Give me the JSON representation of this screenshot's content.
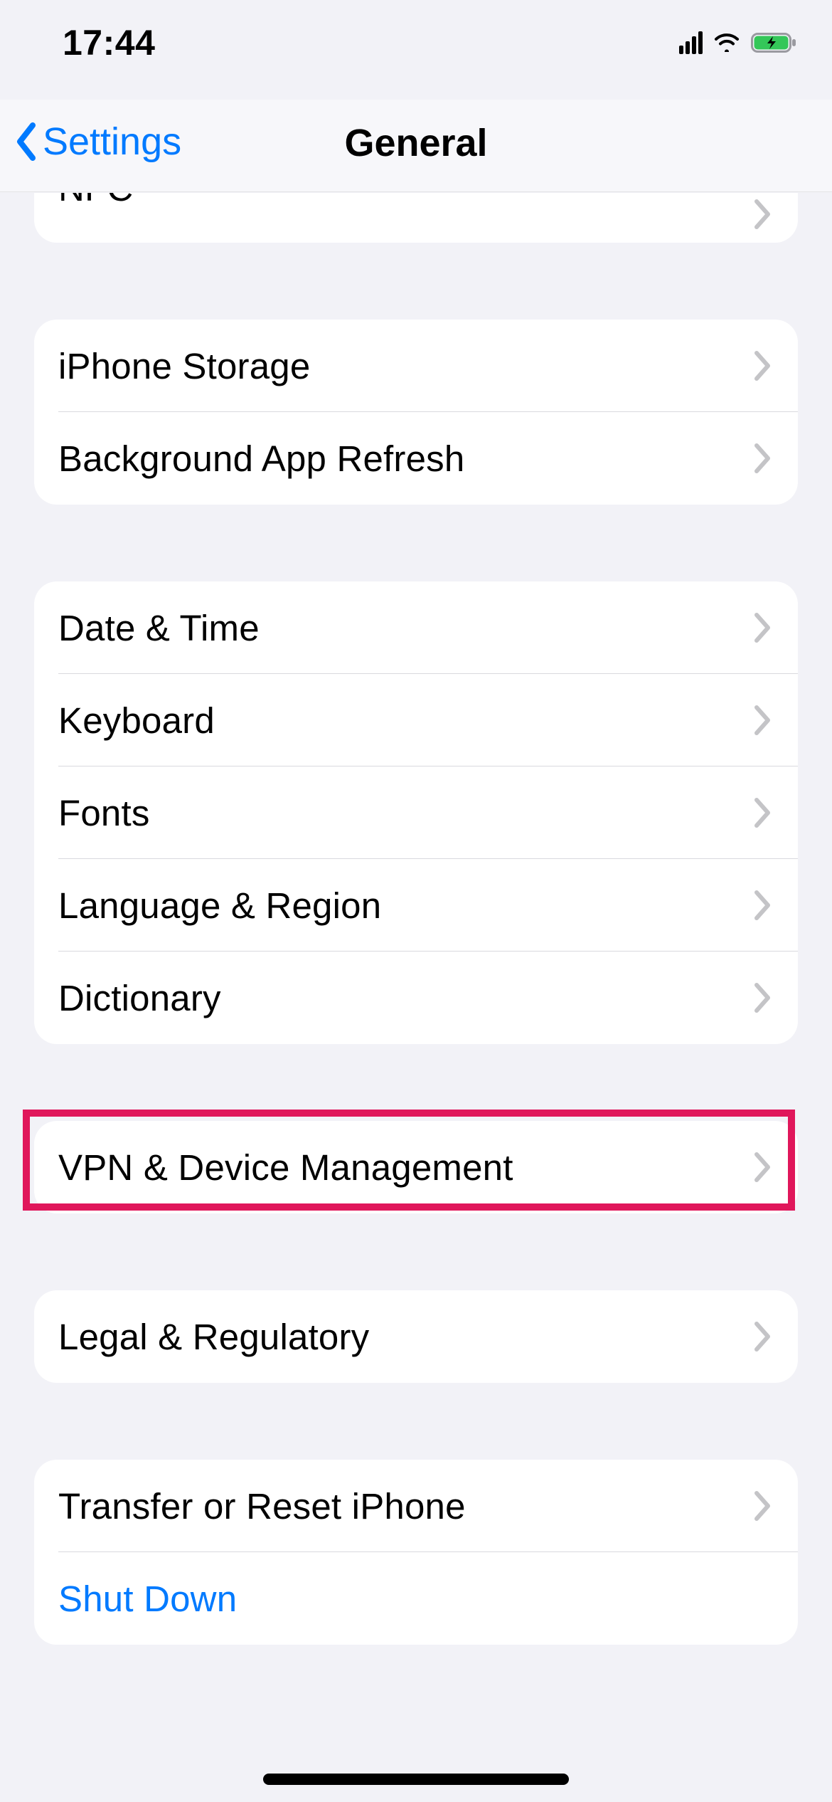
{
  "status": {
    "time": "17:44"
  },
  "nav": {
    "back_label": "Settings",
    "title": "General"
  },
  "colors": {
    "accent": "#007aff",
    "highlight": "#e0175b",
    "battery_fill": "#34c759"
  },
  "peek_row": {
    "label": "NFC"
  },
  "groups": [
    {
      "rows": [
        {
          "label": "iPhone Storage",
          "chevron": true
        },
        {
          "label": "Background App Refresh",
          "chevron": true
        }
      ]
    },
    {
      "rows": [
        {
          "label": "Date & Time",
          "chevron": true
        },
        {
          "label": "Keyboard",
          "chevron": true
        },
        {
          "label": "Fonts",
          "chevron": true
        },
        {
          "label": "Language & Region",
          "chevron": true
        },
        {
          "label": "Dictionary",
          "chevron": true
        }
      ]
    },
    {
      "highlighted": true,
      "rows": [
        {
          "label": "VPN & Device Management",
          "chevron": true
        }
      ]
    },
    {
      "rows": [
        {
          "label": "Legal & Regulatory",
          "chevron": true
        }
      ]
    },
    {
      "rows": [
        {
          "label": "Transfer or Reset iPhone",
          "chevron": true
        },
        {
          "label": "Shut Down",
          "chevron": false,
          "link": true
        }
      ]
    }
  ],
  "highlight": {
    "group_index": 2
  }
}
